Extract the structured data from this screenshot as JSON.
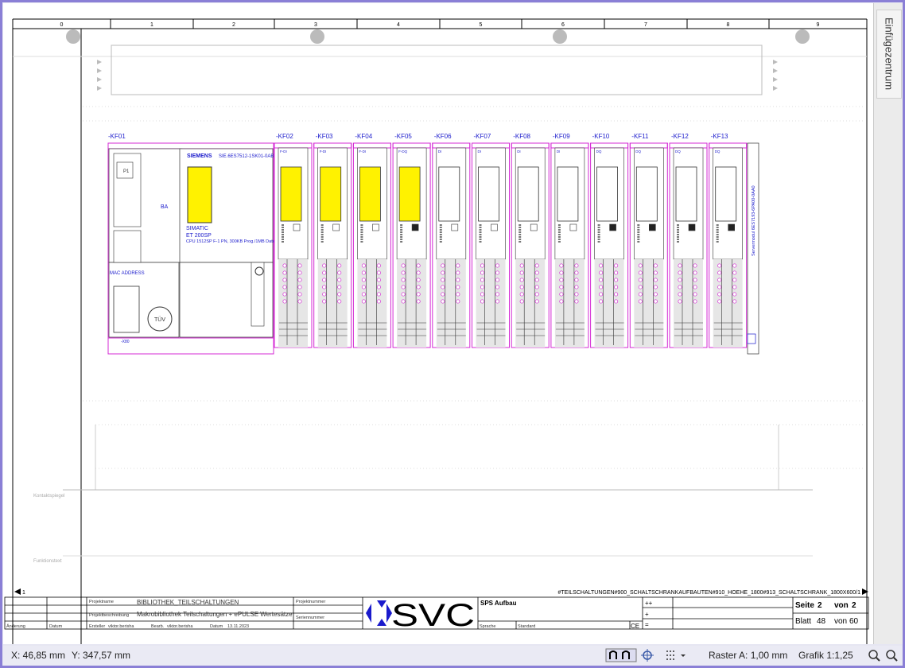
{
  "side_panel": {
    "tab_label": "Einfügezentrum"
  },
  "ruler": {
    "columns": [
      "0",
      "1",
      "2",
      "3",
      "4",
      "5",
      "6",
      "7",
      "8",
      "9"
    ]
  },
  "modules": {
    "cpu": {
      "tag": "-KF01",
      "brand": "SIEMENS",
      "order_no": "SIE.6ES7512-1SK01-0AB0",
      "line1": "SIMATIC",
      "line2": "ET 200SP",
      "line3": "CPU 1512SP F-1 PN, 300KB Prog./1MB Daten",
      "ba": "BA",
      "mac": "MAC ADDRESS",
      "port": "P1",
      "x": "-X80",
      "tuv": "TÜV"
    },
    "io_tags": [
      "-KF02",
      "-KF03",
      "-KF04",
      "-KF05",
      "-KF06",
      "-KF07",
      "-KF08",
      "-KF09",
      "-KF10",
      "-KF11",
      "-KF12",
      "-KF13"
    ],
    "io_types": [
      "F-DI",
      "F-DI",
      "F-DI",
      "F-DQ",
      "DI",
      "DI",
      "DI",
      "DI",
      "DQ",
      "DQ",
      "DQ",
      "DQ"
    ],
    "io_yellow": [
      true,
      true,
      true,
      true,
      false,
      false,
      false,
      false,
      false,
      false,
      false,
      false
    ],
    "io_dark": [
      false,
      false,
      false,
      true,
      false,
      false,
      false,
      false,
      true,
      true,
      true,
      true
    ],
    "servermodul": "Servermodul 6ES7193-6PA00-0AA0"
  },
  "labels": {
    "kontaktspiegel": "Kontaktspiegel",
    "funktionstext": "Funktionstext"
  },
  "page_nav": {
    "prev": "1",
    "path": "#TEILSCHALTUNGEN#900_SCHALTSCHRANKAUFBAUTEN#910_HOEHE_1800#913_SCHALTSCHRANK_1800X600/1"
  },
  "title_block": {
    "projektname_label": "Projektname",
    "projektname": "BIBLIOTHEK_TEILSCHALTUNGEN",
    "projektbeschreibung_label": "Projektbeschreibung",
    "projektbeschreibung": "Makrobibliothek Teilschaltungen + ePULSE Wertesätze",
    "projektnummer_label": "Projektnummer",
    "seriennummer_label": "Seriennummer",
    "ersteller_label": "Ersteller",
    "ersteller": "viktor.berisha",
    "bearb_label": "Bearb.",
    "bearb": "viktor.berisha",
    "datum_label": "Datum",
    "datum": "13.11.2023",
    "aenderung_label": "Änderung",
    "datum_col_label": "Datum",
    "logo": "SVC",
    "title": "SPS Aufbau",
    "sprache_label": "Sprache",
    "sprache": "Standard",
    "ce": "CE",
    "plusplus": "++",
    "plus": "+",
    "eq": "=",
    "seite_label": "Seite",
    "seite": "2",
    "von_label": "von",
    "von": "2",
    "blatt_label": "Blatt",
    "blatt": "48",
    "blatt_von": "60"
  },
  "status_bar": {
    "x": "X: 46,85 mm",
    "y": "Y: 347,57 mm",
    "raster": "Raster A: 1,00 mm",
    "grafik": "Grafik 1:1,25"
  },
  "colors": {
    "module": "#d42ad4",
    "accent": "#1a1acc",
    "yellow": "#fff200",
    "frame": "#8a7fd6"
  }
}
